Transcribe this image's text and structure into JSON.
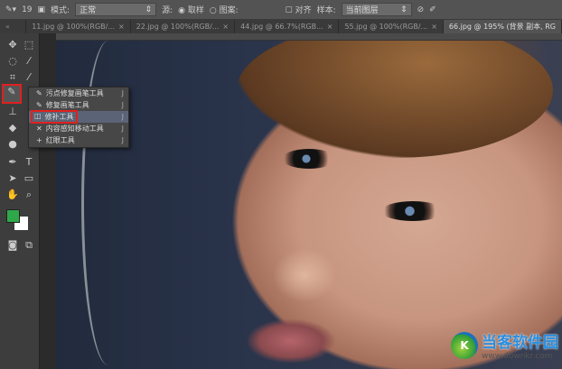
{
  "options_bar": {
    "brush_size": "19",
    "mode_label": "模式:",
    "mode_value": "正常",
    "source_label": "源:",
    "source_sampled": "取样",
    "source_pattern": "图案:",
    "aligned": "对齐",
    "sample_label": "样本:",
    "sample_value": "当前图层"
  },
  "tabs": [
    {
      "label": "11.jpg @ 100%(RGB/...",
      "close": "×"
    },
    {
      "label": "22.jpg @ 100%(RGB/...",
      "close": "×"
    },
    {
      "label": "44.jpg @ 66.7%(RGB...",
      "close": "×"
    },
    {
      "label": "55.jpg @ 100%(RGB/...",
      "close": "×"
    },
    {
      "label": "66.jpg @ 195% (背景 副本, RG",
      "close": ""
    }
  ],
  "flyout": [
    {
      "label": "污点修复画笔工具",
      "key": "J"
    },
    {
      "label": "修复画笔工具",
      "key": "J"
    },
    {
      "label": "修补工具",
      "key": "J"
    },
    {
      "label": "内容感知移动工具",
      "key": "J"
    },
    {
      "label": "红眼工具",
      "key": "J"
    }
  ],
  "colors": {
    "foreground": "#2fa84a",
    "background": "#ffffff",
    "highlight": "#e02020"
  },
  "watermark": {
    "title": "当客软件园",
    "url": "www.downkr.com"
  }
}
